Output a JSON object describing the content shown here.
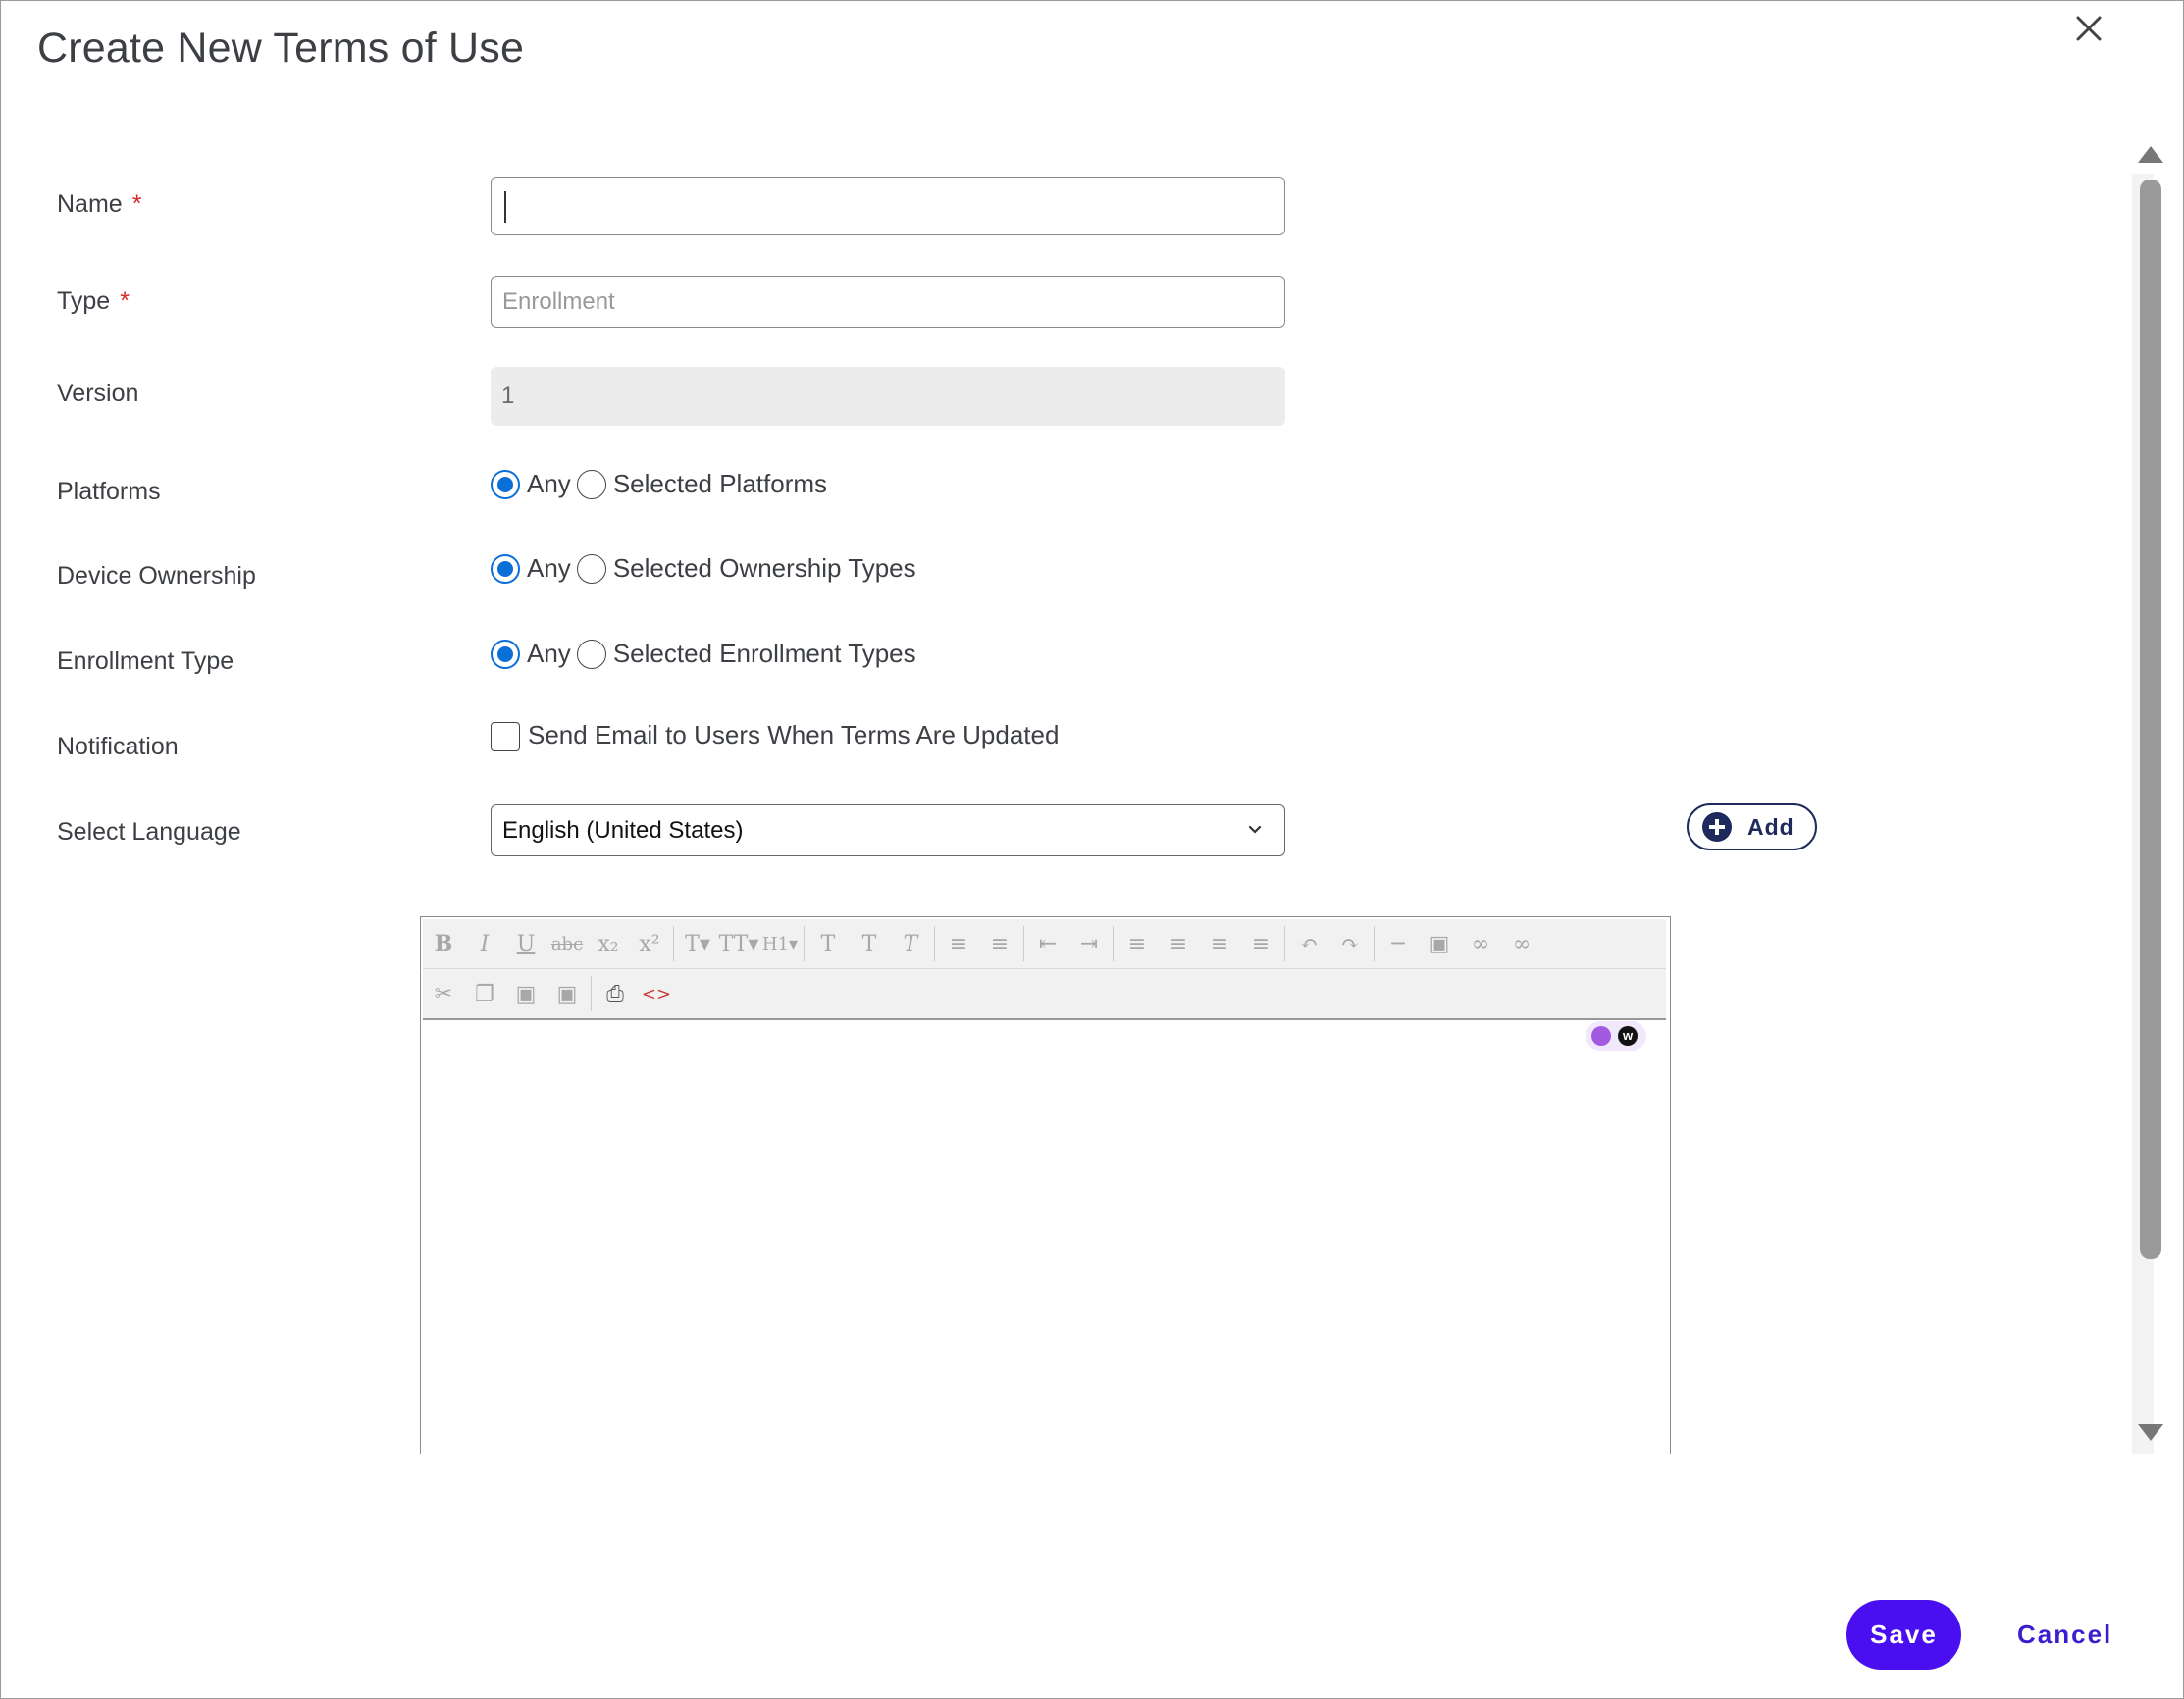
{
  "dialog": {
    "title": "Create New Terms of Use"
  },
  "form": {
    "name": {
      "label": "Name",
      "required_mark": "*",
      "value": ""
    },
    "type": {
      "label": "Type",
      "required_mark": "*",
      "placeholder": "Enrollment"
    },
    "version": {
      "label": "Version",
      "value": "1"
    },
    "platforms": {
      "label": "Platforms",
      "options": [
        "Any",
        "Selected Platforms"
      ],
      "selected": "Any"
    },
    "device_ownership": {
      "label": "Device Ownership",
      "options": [
        "Any",
        "Selected Ownership Types"
      ],
      "selected": "Any"
    },
    "enrollment_type": {
      "label": "Enrollment Type",
      "options": [
        "Any",
        "Selected Enrollment Types"
      ],
      "selected": "Any"
    },
    "notification": {
      "label": "Notification",
      "checkbox_label": "Send Email to Users When Terms Are Updated",
      "checked": false
    },
    "language": {
      "label": "Select Language",
      "selected": "English (United States)",
      "add_label": "Add"
    }
  },
  "editor": {
    "toolbar_row1": [
      "bold-icon",
      "italic-icon",
      "underline-icon",
      "strikethrough-icon",
      "subscript-icon",
      "superscript-icon",
      "font-size-icon",
      "font-family-icon",
      "heading-icon",
      "text-color-icon",
      "highlight-icon",
      "clear-format-icon",
      "bullet-list-icon",
      "numbered-list-icon",
      "outdent-icon",
      "indent-icon",
      "align-left-icon",
      "align-center-icon",
      "align-right-icon",
      "align-justify-icon",
      "undo-icon",
      "redo-icon",
      "horizontal-rule-icon",
      "image-icon",
      "link-icon",
      "unlink-icon"
    ],
    "toolbar_row2": [
      "cut-icon",
      "copy-icon",
      "paste-icon",
      "paste-text-icon",
      "print-icon",
      "source-code-icon"
    ],
    "content": ""
  },
  "footer": {
    "save_label": "Save",
    "cancel_label": "Cancel"
  },
  "colors": {
    "primary": "#4a0ff0",
    "radio_selected": "#0b6fd8",
    "required": "#d62a2a",
    "add_button": "#1f2a5c"
  }
}
